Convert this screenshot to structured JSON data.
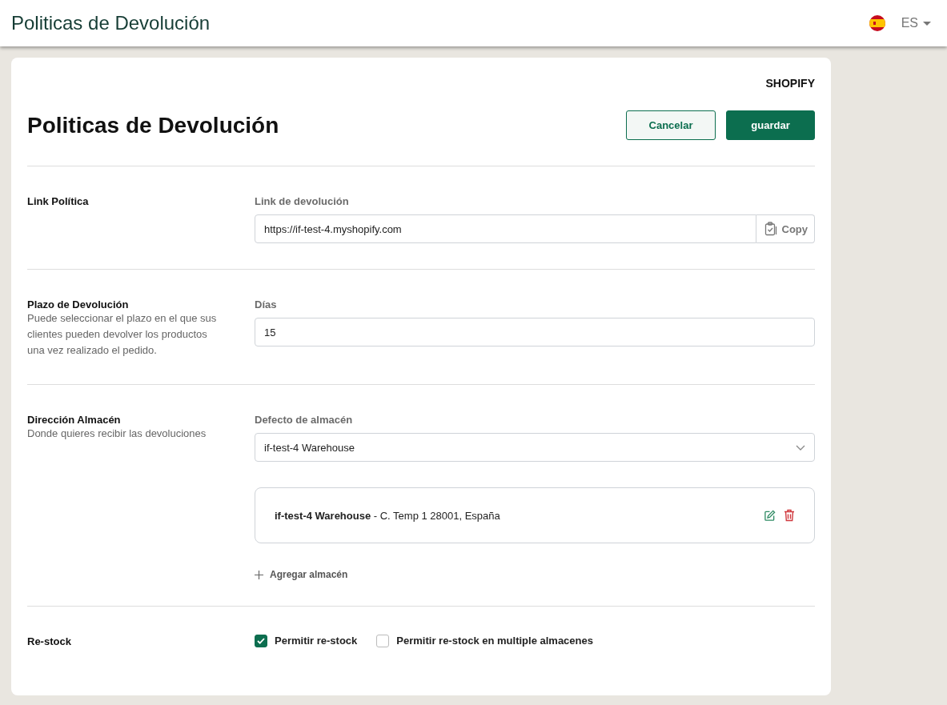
{
  "app_bar": {
    "title": "Politicas de Devolución",
    "language": "ES"
  },
  "card": {
    "platform": "SHOPIFY",
    "title": "Politicas de Devolución",
    "buttons": [
      {
        "label": "Cancelar",
        "kind": "secondary"
      },
      {
        "label": "guardar",
        "kind": "primary"
      }
    ]
  },
  "sections": [
    {
      "kind": "link",
      "title": "Link Política",
      "field_label": "Link de devolución",
      "value": "https://if-test-4.myshopify.com",
      "action": "Copy"
    },
    {
      "kind": "number",
      "title": "Plazo de Devolución",
      "description": "Puede seleccionar el plazo en el que sus clientes pueden devolver los productos una vez realizado el pedido.",
      "field_label": "Días",
      "value": "15"
    },
    {
      "kind": "warehouse",
      "title": "Dirección Almacén",
      "description": "Donde quieres recibir las devoluciones",
      "field_label": "Defecto de almacén",
      "value": "if-test-4 Warehouse",
      "warehouses": [
        "**if-test-4 Warehouse** - C. Temp 1 28001, España"
      ],
      "add_label": "Agregar almacén"
    },
    {
      "kind": "restock",
      "title": "Re-stock",
      "options": [
        {
          "label": "Permitir re-stock",
          "checked": true
        },
        {
          "label": "Permitir re-stock en multiple almacenes",
          "checked": false
        }
      ]
    }
  ]
}
